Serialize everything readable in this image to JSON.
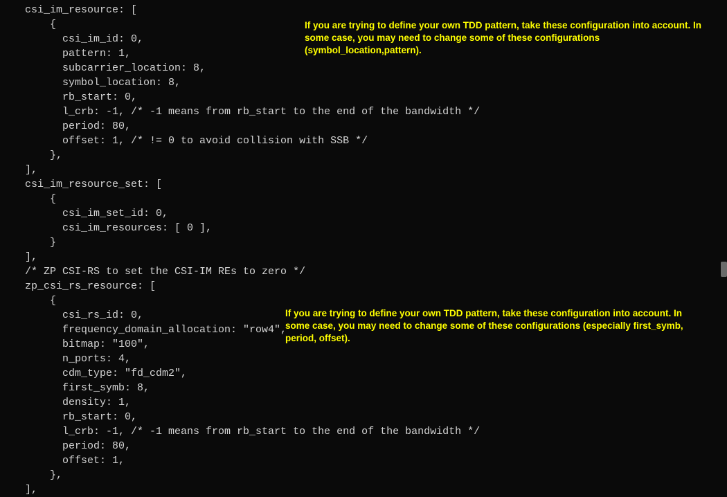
{
  "code": {
    "l1": "csi_im_resource: [",
    "l2": "    {",
    "l3": "      csi_im_id: 0,",
    "l4": "      pattern: 1,",
    "l5": "      subcarrier_location: 8,",
    "l6": "      symbol_location: 8,",
    "l7": "      rb_start: 0,",
    "l8": "      l_crb: -1, /* -1 means from rb_start to the end of the bandwidth */",
    "l9": "      period: 80,",
    "l10": "      offset: 1, /* != 0 to avoid collision with SSB */",
    "l11": "    },",
    "l12": "],",
    "l13": "csi_im_resource_set: [",
    "l14": "    {",
    "l15": "      csi_im_set_id: 0,",
    "l16": "      csi_im_resources: [ 0 ],",
    "l17": "    }",
    "l18": "],",
    "l19": "/* ZP CSI-RS to set the CSI-IM REs to zero */",
    "l20": "zp_csi_rs_resource: [",
    "l21": "    {",
    "l22": "      csi_rs_id: 0,",
    "l23": "      frequency_domain_allocation: \"row4\",",
    "l24": "      bitmap: \"100\",",
    "l25": "      n_ports: 4,",
    "l26": "      cdm_type: \"fd_cdm2\",",
    "l27": "      first_symb: 8,",
    "l28": "      density: 1,",
    "l29": "      rb_start: 0,",
    "l30": "      l_crb: -1, /* -1 means from rb_start to the end of the bandwidth */",
    "l31": "      period: 80,",
    "l32": "      offset: 1,",
    "l33": "    },",
    "l34": "],"
  },
  "annotations": {
    "a1": "If you are trying to define your own TDD pattern, take these configuration into account. In some case, you may need to change some of these configurations (symbol_location,pattern).",
    "a2": "If you are trying to define your own TDD pattern, take these configuration into account. In some case, you may need to change some of these configurations (especially first_symb, period, offset)."
  }
}
